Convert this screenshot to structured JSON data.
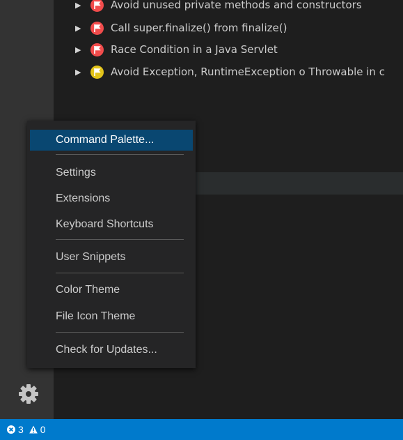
{
  "problems": [
    {
      "label": "Avoid unused private methods and constructors",
      "severity": "error",
      "color": "#f14c4c"
    },
    {
      "label": "Call super.finalize() from finalize()",
      "severity": "error",
      "color": "#f14c4c"
    },
    {
      "label": "Race Condition in a Java Servlet",
      "severity": "error",
      "color": "#f14c4c"
    },
    {
      "label": "Avoid Exception, RuntimeException o Throwable in c",
      "severity": "warning",
      "color": "#e2c31a"
    }
  ],
  "menu": {
    "command_palette": "Command Palette...",
    "settings": "Settings",
    "extensions": "Extensions",
    "keyboard_shortcuts": "Keyboard Shortcuts",
    "user_snippets": "User Snippets",
    "color_theme": "Color Theme",
    "file_icon_theme": "File Icon Theme",
    "check_for_updates": "Check for Updates..."
  },
  "activity_bar": {
    "manage_icon": "gear-icon"
  },
  "status_bar": {
    "errors": "3",
    "warnings": "0",
    "error_icon": "error-circle-icon",
    "warning_icon": "warning-triangle-icon"
  },
  "colors": {
    "status_bar": "#007acc",
    "menu_selection": "#094771",
    "menu_background": "#252526",
    "activity_bar": "#333333",
    "editor": "#1e1e1e"
  }
}
